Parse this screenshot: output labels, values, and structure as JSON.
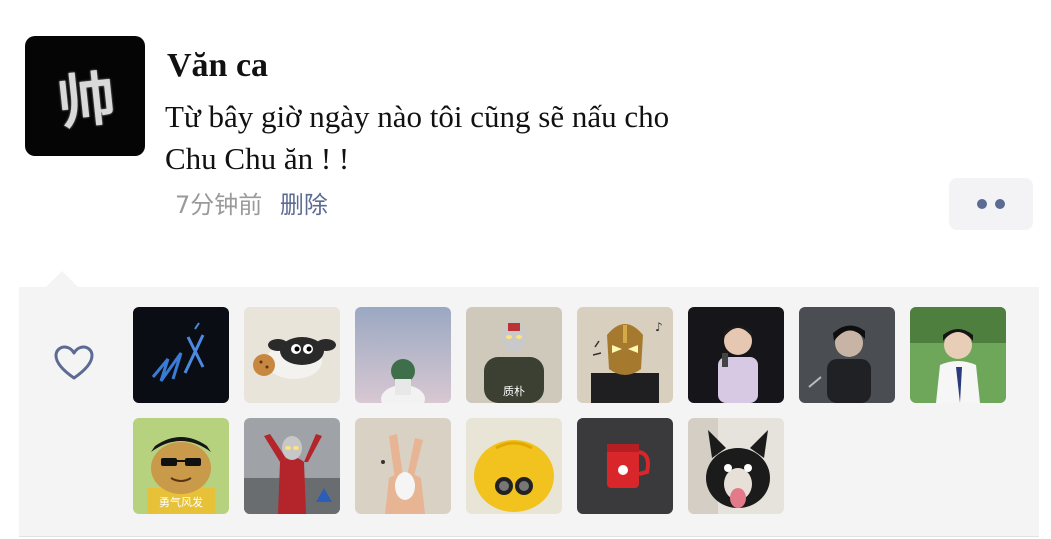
{
  "post": {
    "avatar_text": "帅",
    "username": "Văn ca",
    "text_line1": "Từ bây giờ ngày nào tôi cũng sẽ nấu cho",
    "text_line2": "Chu Chu ăn ! !",
    "time": "7分钟前",
    "delete_label": "删除"
  },
  "more_button": {
    "icon": "more-dots-icon"
  },
  "likes": {
    "icon": "heart-icon",
    "accent_color": "#5b6b93",
    "avatars": [
      {
        "name": "liker-1",
        "caption": ""
      },
      {
        "name": "liker-2",
        "caption": ""
      },
      {
        "name": "liker-3",
        "caption": ""
      },
      {
        "name": "liker-4",
        "caption": "质朴"
      },
      {
        "name": "liker-5",
        "caption": ""
      },
      {
        "name": "liker-6",
        "caption": ""
      },
      {
        "name": "liker-7",
        "caption": ""
      },
      {
        "name": "liker-8",
        "caption": ""
      },
      {
        "name": "liker-9",
        "caption": "勇气风发"
      },
      {
        "name": "liker-10",
        "caption": ""
      },
      {
        "name": "liker-11",
        "caption": ""
      },
      {
        "name": "liker-12",
        "caption": ""
      },
      {
        "name": "liker-13",
        "caption": ""
      },
      {
        "name": "liker-14",
        "caption": ""
      }
    ]
  }
}
